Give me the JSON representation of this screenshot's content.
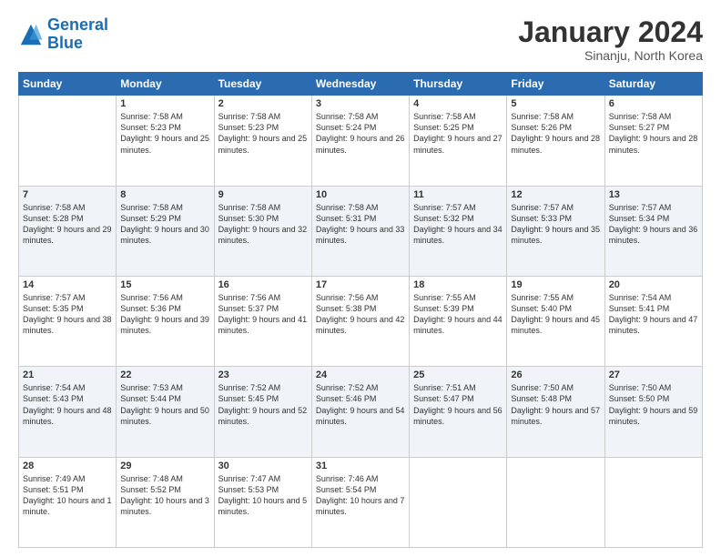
{
  "header": {
    "logo_general": "General",
    "logo_blue": "Blue",
    "month_title": "January 2024",
    "location": "Sinanju, North Korea"
  },
  "days_of_week": [
    "Sunday",
    "Monday",
    "Tuesday",
    "Wednesday",
    "Thursday",
    "Friday",
    "Saturday"
  ],
  "weeks": [
    [
      {
        "day": "",
        "sunrise": "",
        "sunset": "",
        "daylight": "",
        "empty": true
      },
      {
        "day": "1",
        "sunrise": "Sunrise: 7:58 AM",
        "sunset": "Sunset: 5:23 PM",
        "daylight": "Daylight: 9 hours and 25 minutes."
      },
      {
        "day": "2",
        "sunrise": "Sunrise: 7:58 AM",
        "sunset": "Sunset: 5:23 PM",
        "daylight": "Daylight: 9 hours and 25 minutes."
      },
      {
        "day": "3",
        "sunrise": "Sunrise: 7:58 AM",
        "sunset": "Sunset: 5:24 PM",
        "daylight": "Daylight: 9 hours and 26 minutes."
      },
      {
        "day": "4",
        "sunrise": "Sunrise: 7:58 AM",
        "sunset": "Sunset: 5:25 PM",
        "daylight": "Daylight: 9 hours and 27 minutes."
      },
      {
        "day": "5",
        "sunrise": "Sunrise: 7:58 AM",
        "sunset": "Sunset: 5:26 PM",
        "daylight": "Daylight: 9 hours and 28 minutes."
      },
      {
        "day": "6",
        "sunrise": "Sunrise: 7:58 AM",
        "sunset": "Sunset: 5:27 PM",
        "daylight": "Daylight: 9 hours and 28 minutes."
      }
    ],
    [
      {
        "day": "7",
        "sunrise": "Sunrise: 7:58 AM",
        "sunset": "Sunset: 5:28 PM",
        "daylight": "Daylight: 9 hours and 29 minutes."
      },
      {
        "day": "8",
        "sunrise": "Sunrise: 7:58 AM",
        "sunset": "Sunset: 5:29 PM",
        "daylight": "Daylight: 9 hours and 30 minutes."
      },
      {
        "day": "9",
        "sunrise": "Sunrise: 7:58 AM",
        "sunset": "Sunset: 5:30 PM",
        "daylight": "Daylight: 9 hours and 32 minutes."
      },
      {
        "day": "10",
        "sunrise": "Sunrise: 7:58 AM",
        "sunset": "Sunset: 5:31 PM",
        "daylight": "Daylight: 9 hours and 33 minutes."
      },
      {
        "day": "11",
        "sunrise": "Sunrise: 7:57 AM",
        "sunset": "Sunset: 5:32 PM",
        "daylight": "Daylight: 9 hours and 34 minutes."
      },
      {
        "day": "12",
        "sunrise": "Sunrise: 7:57 AM",
        "sunset": "Sunset: 5:33 PM",
        "daylight": "Daylight: 9 hours and 35 minutes."
      },
      {
        "day": "13",
        "sunrise": "Sunrise: 7:57 AM",
        "sunset": "Sunset: 5:34 PM",
        "daylight": "Daylight: 9 hours and 36 minutes."
      }
    ],
    [
      {
        "day": "14",
        "sunrise": "Sunrise: 7:57 AM",
        "sunset": "Sunset: 5:35 PM",
        "daylight": "Daylight: 9 hours and 38 minutes."
      },
      {
        "day": "15",
        "sunrise": "Sunrise: 7:56 AM",
        "sunset": "Sunset: 5:36 PM",
        "daylight": "Daylight: 9 hours and 39 minutes."
      },
      {
        "day": "16",
        "sunrise": "Sunrise: 7:56 AM",
        "sunset": "Sunset: 5:37 PM",
        "daylight": "Daylight: 9 hours and 41 minutes."
      },
      {
        "day": "17",
        "sunrise": "Sunrise: 7:56 AM",
        "sunset": "Sunset: 5:38 PM",
        "daylight": "Daylight: 9 hours and 42 minutes."
      },
      {
        "day": "18",
        "sunrise": "Sunrise: 7:55 AM",
        "sunset": "Sunset: 5:39 PM",
        "daylight": "Daylight: 9 hours and 44 minutes."
      },
      {
        "day": "19",
        "sunrise": "Sunrise: 7:55 AM",
        "sunset": "Sunset: 5:40 PM",
        "daylight": "Daylight: 9 hours and 45 minutes."
      },
      {
        "day": "20",
        "sunrise": "Sunrise: 7:54 AM",
        "sunset": "Sunset: 5:41 PM",
        "daylight": "Daylight: 9 hours and 47 minutes."
      }
    ],
    [
      {
        "day": "21",
        "sunrise": "Sunrise: 7:54 AM",
        "sunset": "Sunset: 5:43 PM",
        "daylight": "Daylight: 9 hours and 48 minutes."
      },
      {
        "day": "22",
        "sunrise": "Sunrise: 7:53 AM",
        "sunset": "Sunset: 5:44 PM",
        "daylight": "Daylight: 9 hours and 50 minutes."
      },
      {
        "day": "23",
        "sunrise": "Sunrise: 7:52 AM",
        "sunset": "Sunset: 5:45 PM",
        "daylight": "Daylight: 9 hours and 52 minutes."
      },
      {
        "day": "24",
        "sunrise": "Sunrise: 7:52 AM",
        "sunset": "Sunset: 5:46 PM",
        "daylight": "Daylight: 9 hours and 54 minutes."
      },
      {
        "day": "25",
        "sunrise": "Sunrise: 7:51 AM",
        "sunset": "Sunset: 5:47 PM",
        "daylight": "Daylight: 9 hours and 56 minutes."
      },
      {
        "day": "26",
        "sunrise": "Sunrise: 7:50 AM",
        "sunset": "Sunset: 5:48 PM",
        "daylight": "Daylight: 9 hours and 57 minutes."
      },
      {
        "day": "27",
        "sunrise": "Sunrise: 7:50 AM",
        "sunset": "Sunset: 5:50 PM",
        "daylight": "Daylight: 9 hours and 59 minutes."
      }
    ],
    [
      {
        "day": "28",
        "sunrise": "Sunrise: 7:49 AM",
        "sunset": "Sunset: 5:51 PM",
        "daylight": "Daylight: 10 hours and 1 minute."
      },
      {
        "day": "29",
        "sunrise": "Sunrise: 7:48 AM",
        "sunset": "Sunset: 5:52 PM",
        "daylight": "Daylight: 10 hours and 3 minutes."
      },
      {
        "day": "30",
        "sunrise": "Sunrise: 7:47 AM",
        "sunset": "Sunset: 5:53 PM",
        "daylight": "Daylight: 10 hours and 5 minutes."
      },
      {
        "day": "31",
        "sunrise": "Sunrise: 7:46 AM",
        "sunset": "Sunset: 5:54 PM",
        "daylight": "Daylight: 10 hours and 7 minutes."
      },
      {
        "day": "",
        "sunrise": "",
        "sunset": "",
        "daylight": "",
        "empty": true
      },
      {
        "day": "",
        "sunrise": "",
        "sunset": "",
        "daylight": "",
        "empty": true
      },
      {
        "day": "",
        "sunrise": "",
        "sunset": "",
        "daylight": "",
        "empty": true
      }
    ]
  ]
}
